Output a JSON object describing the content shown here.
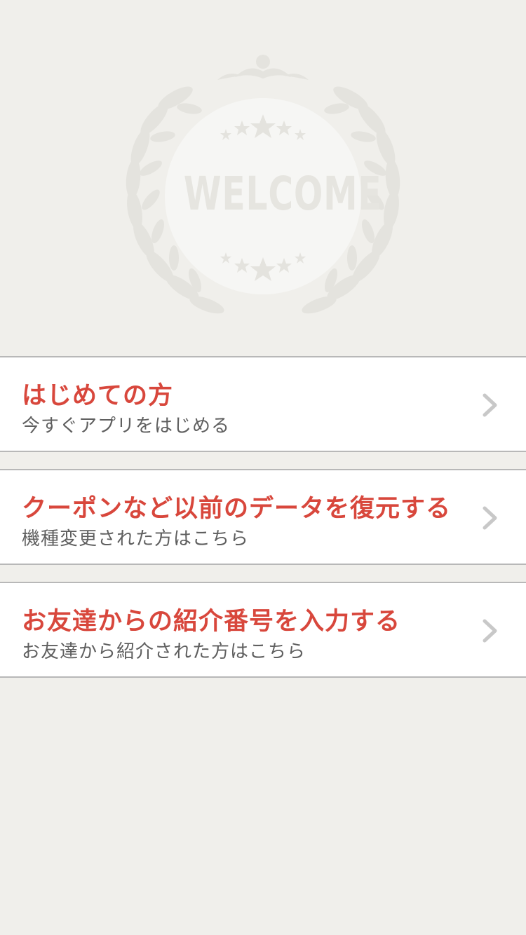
{
  "hero": {
    "emblem_text": "WELCOME",
    "colors": {
      "wreath": "#e4e3de",
      "circle": "#f6f6f4",
      "text": "#e6e5e0"
    }
  },
  "menu": [
    {
      "title": "はじめての方",
      "subtitle": "今すぐアプリをはじめる",
      "icon": "chevron-right-icon"
    },
    {
      "title": "クーポンなど以前のデータを復元する",
      "subtitle": "機種変更された方はこちら",
      "icon": "chevron-right-icon"
    },
    {
      "title": "お友達からの紹介番号を入力する",
      "subtitle": "お友達から紹介された方はこちら",
      "icon": "chevron-right-icon"
    }
  ],
  "colors": {
    "accent": "#d8473c",
    "background": "#f0efeb",
    "subtext": "#5f5f5f"
  }
}
